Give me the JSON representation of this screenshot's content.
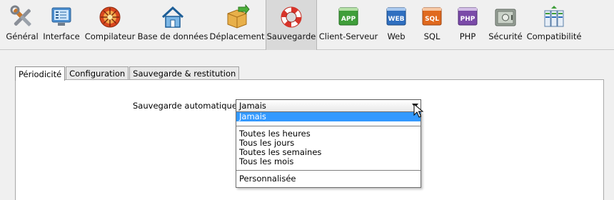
{
  "toolbar": {
    "items": [
      {
        "label": "Général",
        "icon": "tools-icon"
      },
      {
        "label": "Interface",
        "icon": "monitor-icon"
      },
      {
        "label": "Compilateur",
        "icon": "compiler-icon"
      },
      {
        "label": "Base de données",
        "icon": "home-database-icon"
      },
      {
        "label": "Déplacement",
        "icon": "box-move-icon"
      },
      {
        "label": "Sauvegarde",
        "icon": "lifebuoy-icon",
        "active": true
      },
      {
        "label": "Client-Serveur",
        "icon": "app-icon",
        "badge": "APP"
      },
      {
        "label": "Web",
        "icon": "web-icon",
        "badge": "WEB"
      },
      {
        "label": "SQL",
        "icon": "sql-icon",
        "badge": "SQL"
      },
      {
        "label": "PHP",
        "icon": "php-icon",
        "badge": "PHP"
      },
      {
        "label": "Sécurité",
        "icon": "safe-icon"
      },
      {
        "label": "Compatibilité",
        "icon": "compatibility-icon"
      }
    ]
  },
  "tabs": [
    {
      "label": "Périodicité",
      "active": true
    },
    {
      "label": "Configuration"
    },
    {
      "label": "Sauvegarde & restitution"
    }
  ],
  "form": {
    "auto_backup_label": "Sauvegarde automatique :",
    "auto_backup_value": "Jamais"
  },
  "dropdown": {
    "groups": [
      [
        "Jamais"
      ],
      [
        "Toutes les heures",
        "Tous les jours",
        "Toutes les semaines",
        "Tous les mois"
      ],
      [
        "Personnalisée"
      ]
    ],
    "selected": "Jamais"
  },
  "colors": {
    "selection": "#3399ff",
    "active_tool_bg": "#d9d9d9"
  }
}
